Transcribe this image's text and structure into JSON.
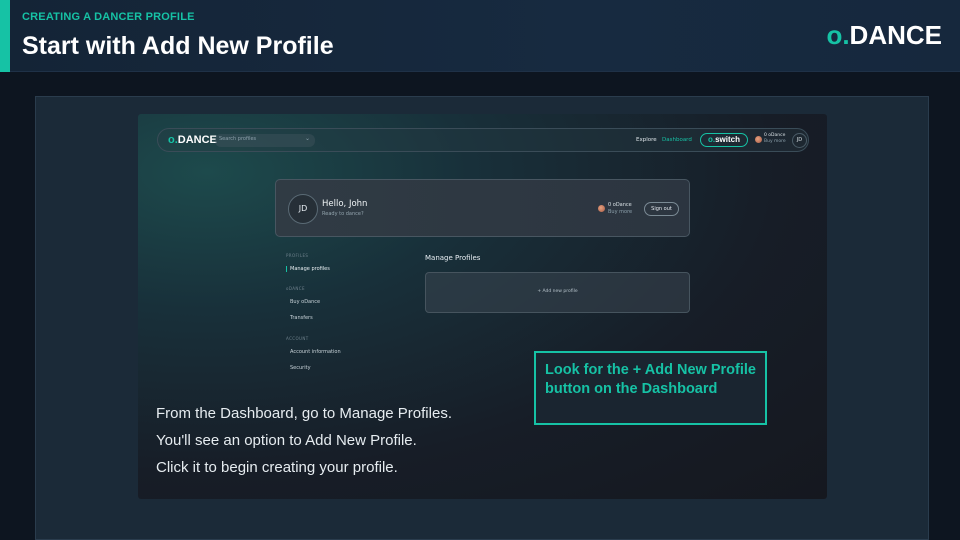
{
  "slide": {
    "eyebrow": "CREATING A DANCER PROFILE",
    "title": "Start with Add New Profile",
    "brand_o": "o.",
    "brand_rest": "DANCE",
    "accent_color": "#16c2a5"
  },
  "app": {
    "logo_o": "o.",
    "logo_rest": "DANCE",
    "search_placeholder": "Search profiles",
    "nav_explore": "Explore",
    "nav_dashboard": "Dashboard",
    "switch_o": "o.",
    "switch_rest": "switch",
    "balance_label": "0 oDance",
    "balance_link": "Buy more",
    "avatar_initials": "JD"
  },
  "profile_card": {
    "initials": "JD",
    "greeting": "Hello, John",
    "subtitle": "Ready to dance?",
    "balance_label": "0 oDance",
    "balance_link": "Buy more",
    "signout_label": "Sign out"
  },
  "sidebar": {
    "profiles_heading": "PROFILES",
    "manage_profiles": "Manage profiles",
    "odance_heading": "oDANCE",
    "buy_odance": "Buy oDance",
    "transfers": "Transfers",
    "account_heading": "ACCOUNT",
    "account_information": "Account information",
    "security": "Security"
  },
  "main": {
    "title": "Manage Profiles",
    "add_new_profile": "+ Add new profile"
  },
  "instructions": [
    "From the Dashboard, go to Manage Profiles.",
    "You'll see an option to Add New Profile.",
    "Click it to begin creating your profile."
  ],
  "callout": "Look for the + Add New Profile button on the Dashboard"
}
